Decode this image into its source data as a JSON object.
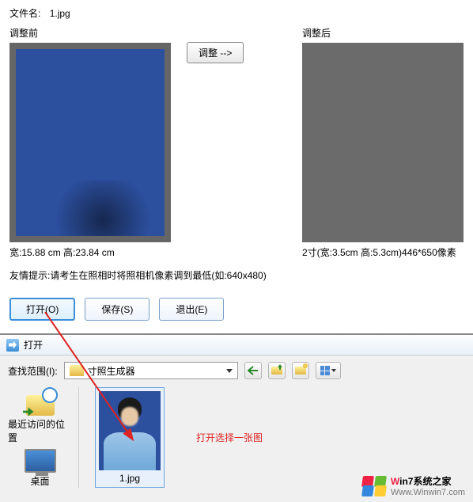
{
  "file_name_label": "文件名:",
  "file_name": "1.jpg",
  "before_label": "调整前",
  "after_label": "调整后",
  "adjust_button": "调整 -->",
  "before_dims": "宽:15.88 cm 高:23.84 cm",
  "after_dims": "2寸(宽:3.5cm 高:5.3cm)446*650像素",
  "tip": "友情提示:请考生在照相时将照相机像素调到最低(如:640x480)",
  "buttons": {
    "open": "打开(O)",
    "save": "保存(S)",
    "exit": "退出(E)"
  },
  "dialog": {
    "title": "打开",
    "lookup_label": "查找范围(I):",
    "folder_name": "寸照生成器",
    "places": {
      "recent": "最近访问的位置",
      "desktop": "桌面"
    },
    "thumb_name": "1.jpg",
    "annotation": "打开选择一张图"
  },
  "watermark": {
    "line1_prefix": "W",
    "line1_rest": "in7系统之家",
    "line2": "Www.Winwin7.com"
  }
}
